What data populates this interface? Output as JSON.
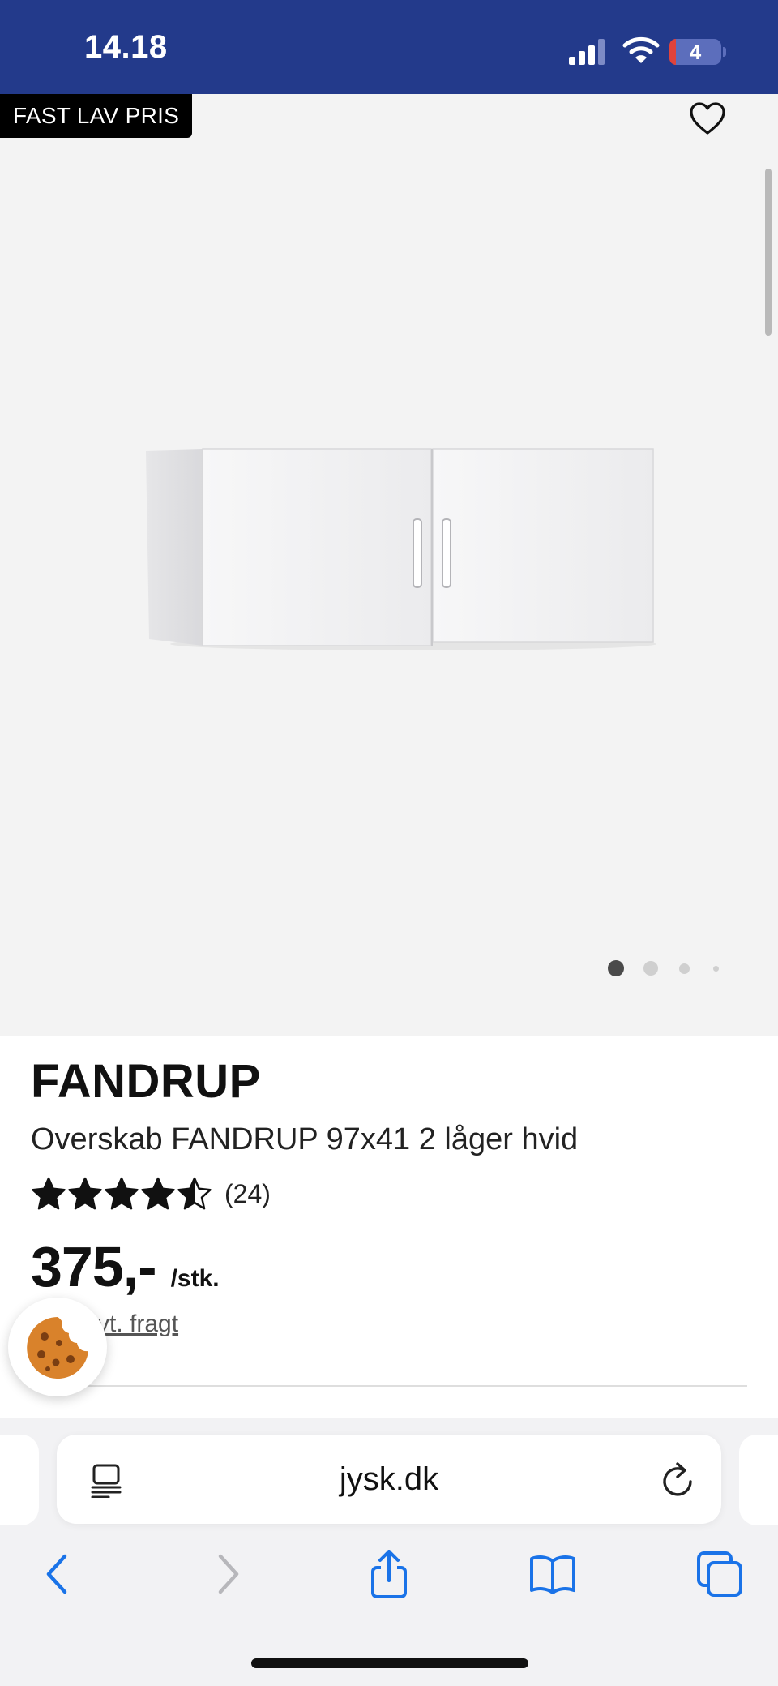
{
  "status_bar": {
    "time": "14.18",
    "battery_level": "4"
  },
  "product_image": {
    "badge": "FAST LAV PRIS",
    "image_count": 4,
    "active_image_index": 0
  },
  "product": {
    "brand": "FANDRUP",
    "subtitle": "Overskab FANDRUP 97x41 2 låger hvid",
    "rating": 4.5,
    "rating_max": 5,
    "review_count": "(24)",
    "price": "375,-",
    "unit": "/stk.",
    "freight_text": "vt. fragt"
  },
  "browser": {
    "url": "jysk.dk"
  },
  "colors": {
    "status_bar_bg": "#233a8b",
    "ios_blue": "#1a73e8",
    "image_bg": "#f3f3f3"
  },
  "icons": {
    "heart": "heart-icon",
    "cookie": "cookie-icon",
    "reader": "reader-mode-icon",
    "reload": "reload-icon",
    "back": "chevron-left-icon",
    "forward": "chevron-right-icon",
    "share": "share-icon",
    "bookmarks": "book-icon",
    "tabs": "tabs-icon"
  }
}
